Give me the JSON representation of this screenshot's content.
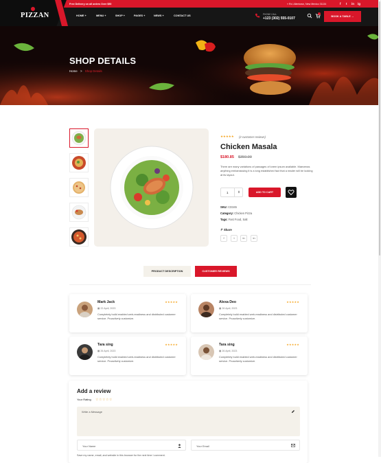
{
  "topbar": {
    "promo": "Free Delivery on all orders Over $50",
    "address": "Rd. Allentown, New Mexico 31134",
    "social": [
      "f",
      "t",
      "in",
      "ig"
    ]
  },
  "header": {
    "logo": "PIZZAN",
    "nav": [
      {
        "label": "HOME +"
      },
      {
        "label": "MENU +"
      },
      {
        "label": "SHOP +"
      },
      {
        "label": "PAGES +"
      },
      {
        "label": "NEWS +"
      },
      {
        "label": "CONTACT US"
      }
    ],
    "call_label": "PHONE CALL",
    "phone": "+123 (302) 555-0107",
    "book_label": "BOOK A TABLE →"
  },
  "hero": {
    "title": "SHOP DETAILS",
    "breadcrumb": {
      "home": "Home",
      "sep": ">",
      "current": "Shop Details"
    }
  },
  "product": {
    "rating_stars": "★★★★★",
    "rating": 5,
    "review_count": "(2 customer reviews)",
    "title": "Chicken Masala",
    "price": "$180.85",
    "old_price": "$350.99",
    "description": "There are many variations of passages of lorem ipsum available. Maecenas anything embarrassing it is a long established fact that a reader will be looking at its layout.",
    "quantity": "1",
    "add_to_cart": "ADD TO CART",
    "sku_label": "SKU:",
    "sku": "CD345",
    "category_label": "Category:",
    "category": "Chicken Pizza",
    "tags_label": "Tags:",
    "tags": "Fast Food, Salt",
    "share_label": "Share",
    "share_icons": [
      "f",
      "t",
      "in",
      "in"
    ]
  },
  "tabs": [
    {
      "label": "PRODUCT DESCRIPTION"
    },
    {
      "label": "CUSTOMER REVIEWS"
    }
  ],
  "reviews": [
    {
      "name": "Mark Jack",
      "date": "22 April, 2023",
      "stars": "★★★★★",
      "text": "Completely build enabled web-readiness and distributed customer service. Proactively customize."
    },
    {
      "name": "Alexa Deo",
      "date": "26 April, 2023",
      "stars": "★★★★★",
      "text": "Completely build enabled web-readiness and distributed customer service. Proactively customize."
    },
    {
      "name": "Tara sing",
      "date": "26 April, 2023",
      "stars": "★★★★★",
      "text": "Completely build enabled web-readiness and distributed customer service. Proactively customize."
    },
    {
      "name": "Tara sing",
      "date": "26 April, 2023",
      "stars": "★★★★★",
      "text": "Completely build enabled web-readiness and distributed customer service. Proactively customize."
    }
  ],
  "review_form": {
    "title": "Add a review",
    "rating_label": "Your Rating",
    "rating_stars": "☆☆☆☆☆",
    "message_placeholder": "Write a Message",
    "name_placeholder": "Your Name",
    "email_placeholder": "Your Email",
    "save_text": "Save my name, email, and website in this browser for the next time I comment."
  },
  "colors": {
    "brand": "#d9172a",
    "dark": "#161616",
    "beige": "#f4f1ea",
    "star": "#f5a623"
  }
}
